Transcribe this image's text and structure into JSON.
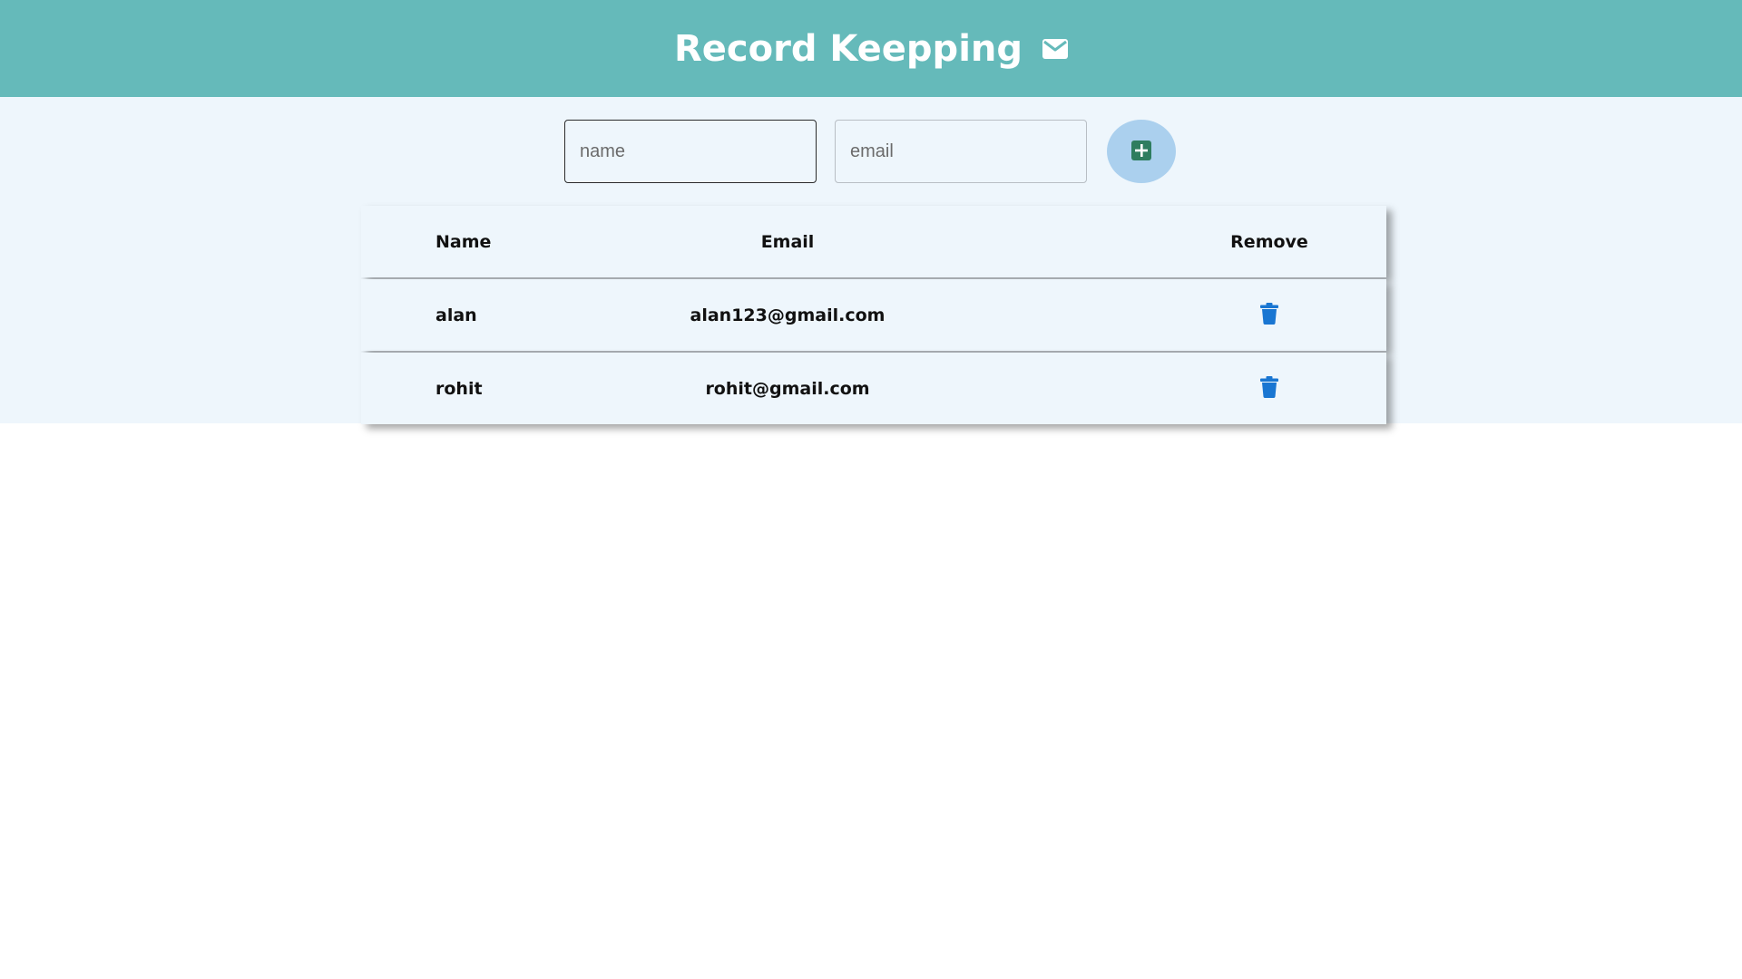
{
  "header": {
    "title": "Record Keepping",
    "icon": "mail-icon"
  },
  "form": {
    "name_placeholder": "name",
    "email_placeholder": "email",
    "add_icon": "plus-square-icon"
  },
  "table": {
    "columns": [
      "Name",
      "Email",
      "Remove"
    ],
    "rows": [
      {
        "name": "alan",
        "email": "alan123@gmail.com",
        "remove_icon": "trash-icon"
      },
      {
        "name": "rohit",
        "email": "rohit@gmail.com",
        "remove_icon": "trash-icon"
      }
    ]
  },
  "colors": {
    "header_bg": "#65baba",
    "band_bg": "#eef6fc",
    "add_button_bg": "#abd0ee",
    "add_icon": "#2e7d5f",
    "trash_icon": "#1976d2"
  }
}
